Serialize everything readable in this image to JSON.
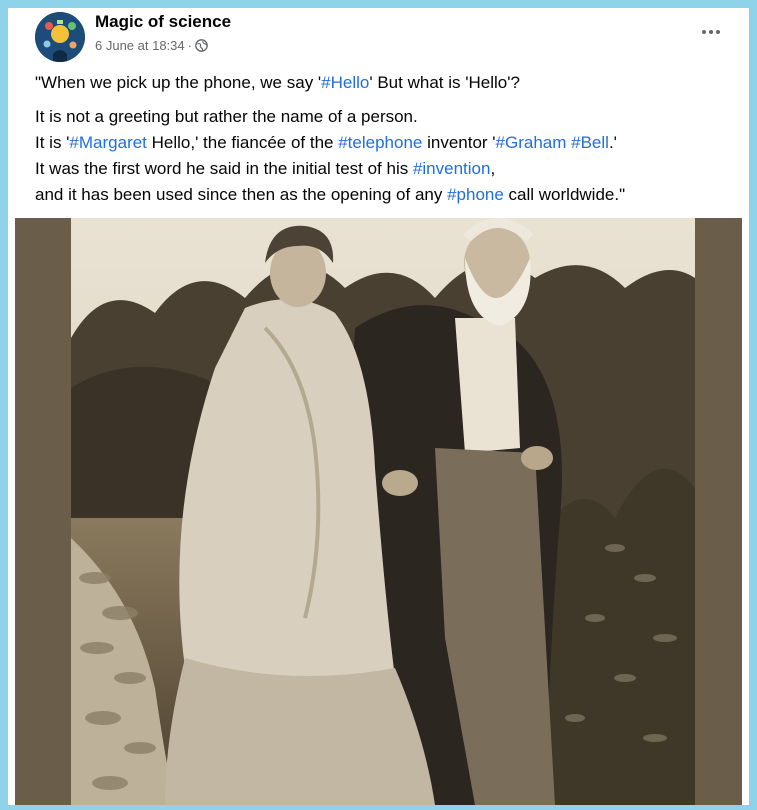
{
  "post": {
    "page_name": "Magic of science",
    "timestamp": "6 June at 18:34",
    "separator": "·",
    "privacy_icon": "globe-icon",
    "more_icon": "more-options-icon",
    "lines": [
      [
        {
          "t": "\"When we pick up the phone, we say '"
        },
        {
          "t": "#Hello",
          "tag": true
        },
        {
          "t": "' But what is 'Hello'?"
        }
      ],
      [
        {
          "t": "It is not a greeting but rather the name of a person."
        }
      ],
      [
        {
          "t": "It is '"
        },
        {
          "t": "#Margaret",
          "tag": true
        },
        {
          "t": " Hello,' the fiancée of the "
        },
        {
          "t": "#telephone",
          "tag": true
        },
        {
          "t": " inventor '"
        },
        {
          "t": "#Graham",
          "tag": true
        },
        {
          "t": " "
        },
        {
          "t": "#Bell",
          "tag": true
        },
        {
          "t": ".'"
        }
      ],
      [
        {
          "t": "It was the first word he said in the initial test of his "
        },
        {
          "t": "#invention",
          "tag": true
        },
        {
          "t": ","
        }
      ],
      [
        {
          "t": "and it has been used since then as the opening of any "
        },
        {
          "t": "#phone",
          "tag": true
        },
        {
          "t": " call worldwide.\""
        }
      ]
    ]
  },
  "colors": {
    "hashtag": "#216fdb",
    "frame_border": "#8fd3ea",
    "photo_background": "#6a5d4a",
    "text": "#050505",
    "meta_text": "#65676b"
  }
}
